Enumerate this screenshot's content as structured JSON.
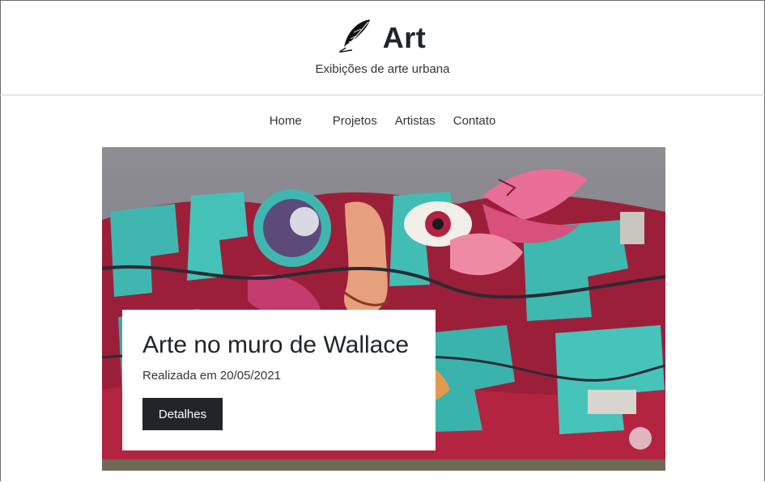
{
  "site": {
    "title": "Art",
    "subtitle": "Exibições de arte urbana",
    "logo_icon": "feather-quill-icon"
  },
  "nav": {
    "items": [
      {
        "label": "Home"
      },
      {
        "label": "Projetos"
      },
      {
        "label": "Artistas"
      },
      {
        "label": "Contato"
      }
    ]
  },
  "featured": {
    "image": "graffiti-mural-image",
    "title": "Arte no muro de Wallace",
    "date": "Realizada em 20/05/2021",
    "button_label": "Detalhes"
  },
  "colors": {
    "text": "#212529",
    "button_bg": "#212529",
    "divider": "#cfcfcf"
  }
}
